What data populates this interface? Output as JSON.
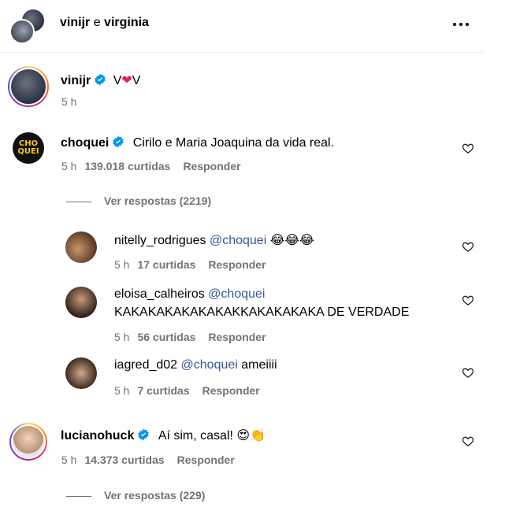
{
  "header": {
    "user1": "vinijr",
    "connector": "e",
    "user2": "virginia",
    "more_icon": "more-horizontal-icon"
  },
  "post": {
    "username": "vinijr",
    "caption_left": "V",
    "caption_right": "V",
    "caption_emoji": "❤",
    "time": "5 h"
  },
  "comments": [
    {
      "username": "choquei",
      "avatar_text": "CHO\nQUEI",
      "text": "Cirilo e Maria Joaquina da vida real.",
      "time": "5 h",
      "likes": "139.018 curtidas",
      "reply": "Responder",
      "view_replies": "Ver respostas (2219)"
    },
    {
      "username": "lucianohuck",
      "text": "Aí sim, casal!",
      "emoji": "😍👏",
      "time": "5 h",
      "likes": "14.373 curtidas",
      "reply": "Responder",
      "view_replies": "Ver respostas (229)"
    }
  ],
  "replies": [
    {
      "username": "nitelly_rodrigues",
      "mention": "@choquei",
      "text": "",
      "emoji": "😂😂😂",
      "time": "5 h",
      "likes": "17 curtidas",
      "reply": "Responder"
    },
    {
      "username": "eloisa_calheiros",
      "mention": "@choquei",
      "text": "KAKAKAKAKAKAKAKKAKAKAKAKA DE VERDADE",
      "time": "5 h",
      "likes": "56 curtidas",
      "reply": "Responder"
    },
    {
      "username": "iagred_d02",
      "mention": "@choquei",
      "text": "ameiiii",
      "time": "5 h",
      "likes": "7 curtidas",
      "reply": "Responder"
    }
  ],
  "colors": {
    "verified": "#0095f6",
    "mention": "#385898",
    "secondary": "#737373",
    "choquei_bg": "#111111",
    "choquei_text": "#f5c518"
  }
}
